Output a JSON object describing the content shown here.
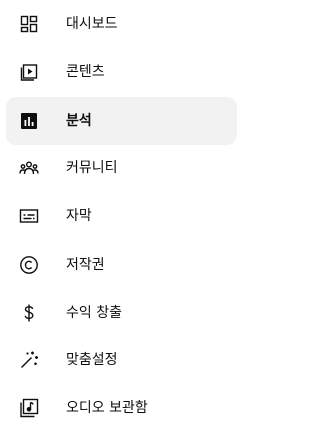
{
  "sidebar": {
    "items": [
      {
        "label": "대시보드",
        "icon": "dashboard-icon",
        "active": false
      },
      {
        "label": "콘텐츠",
        "icon": "content-icon",
        "active": false
      },
      {
        "label": "분석",
        "icon": "analytics-icon",
        "active": true
      },
      {
        "label": "커뮤니티",
        "icon": "community-icon",
        "active": false
      },
      {
        "label": "자막",
        "icon": "subtitles-icon",
        "active": false
      },
      {
        "label": "저작권",
        "icon": "copyright-icon",
        "active": false
      },
      {
        "label": "수익 창출",
        "icon": "monetization-icon",
        "active": false
      },
      {
        "label": "맞춤설정",
        "icon": "customization-icon",
        "active": false
      },
      {
        "label": "오디오 보관함",
        "icon": "audio-library-icon",
        "active": false
      }
    ]
  }
}
